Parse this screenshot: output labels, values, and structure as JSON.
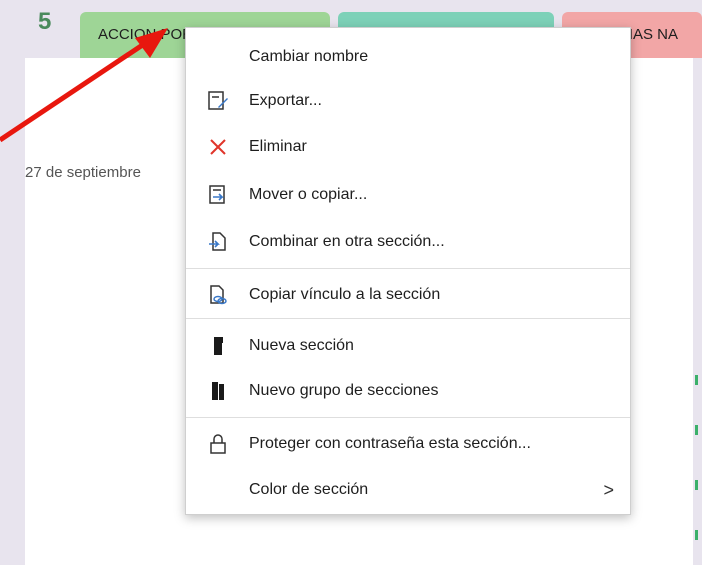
{
  "tabs": {
    "number": "5",
    "accion_label": "ACCION POR EL CLIMA",
    "teal_label": "",
    "pink_label": "CIAS NA"
  },
  "page": {
    "date_fragment": "27 de septiembre"
  },
  "context_menu": {
    "items": [
      {
        "label": "Cambiar nombre",
        "icon": "none"
      },
      {
        "label": "Exportar...",
        "icon": "export-icon"
      },
      {
        "label": "Eliminar",
        "icon": "delete-x-icon"
      },
      {
        "label": "Mover o copiar...",
        "icon": "move-copy-icon"
      },
      {
        "label": "Combinar en otra sección...",
        "icon": "merge-icon"
      },
      {
        "label": "Copiar vínculo a la sección",
        "icon": "copy-link-icon"
      },
      {
        "label": "Nueva sección",
        "icon": "new-section-icon"
      },
      {
        "label": "Nuevo grupo de secciones",
        "icon": "new-section-group-icon"
      },
      {
        "label": "Proteger con contraseña esta sección...",
        "icon": "lock-icon"
      },
      {
        "label": "Color de sección",
        "icon": "none"
      }
    ],
    "submenu_glyph": ">"
  },
  "colors": {
    "delete_icon": "#e0352b",
    "arrow": "#e8170e",
    "tab_green": "#9ed596",
    "tab_teal": "#7dd1b8",
    "tab_pink": "#f2a6a6"
  }
}
